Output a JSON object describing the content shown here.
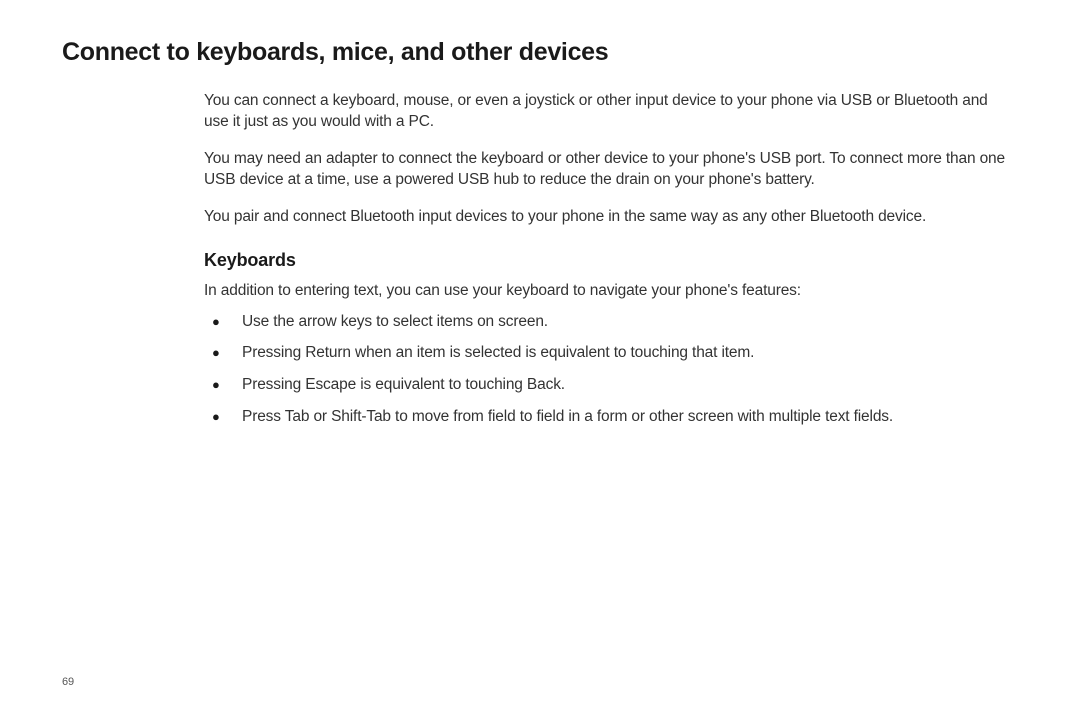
{
  "heading": "Connect to keyboards, mice, and other devices",
  "intro": {
    "p1": "You can connect a keyboard, mouse, or even a joystick or other input device to your phone via USB or Bluetooth and use it just as you would with a PC.",
    "p2": "You may need an adapter to connect the keyboard or other device to your phone's USB port. To connect more than one USB device at a time, use a powered USB hub to reduce the drain on your phone's battery.",
    "p3": "You pair and connect Bluetooth input devices to your phone in the same way as any other Bluetooth device."
  },
  "keyboards": {
    "subheading": "Keyboards",
    "lead": "In addition to entering text, you can use your keyboard to navigate your phone's features:",
    "bullets": [
      "Use the arrow keys to select items on screen.",
      "Pressing Return when an item is selected is equivalent to touching that item.",
      "Pressing Escape is equivalent to touching Back.",
      "Press Tab or Shift-Tab to move from field to field in a form or other screen with multiple text fields."
    ]
  },
  "pageNumber": "69"
}
